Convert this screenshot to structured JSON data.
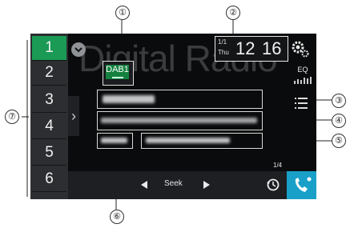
{
  "background_text": "Digital Radio",
  "presets": [
    "1",
    "2",
    "3",
    "4",
    "5",
    "6"
  ],
  "active_preset": "1",
  "band": "DAB1",
  "clock": {
    "date_top": "1/1",
    "date_bottom": "Thu",
    "time_h": "12",
    "time_m": "16"
  },
  "eq_label": "EQ",
  "seek_label": "Seek",
  "page_indicator": "1/4",
  "callouts": [
    "①",
    "②",
    "③",
    "④",
    "⑤",
    "⑥",
    "⑦"
  ],
  "colors": {
    "active_preset": "#1a9a55",
    "phone_button": "#19a0c8",
    "screen_bg": "#0a0b0c"
  }
}
